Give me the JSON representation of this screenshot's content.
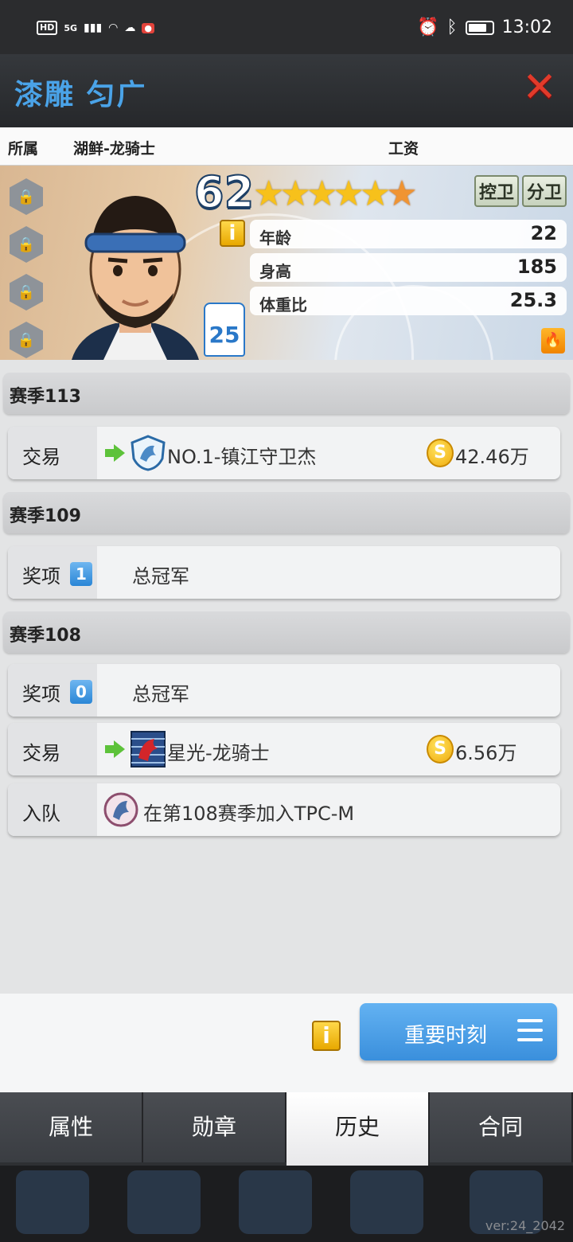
{
  "status_bar": {
    "time": "13:02",
    "network": "5G",
    "hd": "HD"
  },
  "header": {
    "player_name": "漆雕 匀广",
    "close_icon": "close-icon"
  },
  "team_row": {
    "affiliation_label": "所属",
    "team": "湖鲜-龙骑士",
    "salary_label": "工资"
  },
  "player_card": {
    "rating": "62",
    "stars": {
      "full": 5,
      "half": 1
    },
    "positions": [
      "控卫",
      "分卫"
    ],
    "jersey_number": "25",
    "stats": [
      {
        "label": "年龄",
        "value": "22"
      },
      {
        "label": "身高",
        "value": "185"
      },
      {
        "label": "体重比",
        "value": "25.3"
      }
    ],
    "info_icon": "i"
  },
  "history": {
    "seasons": [
      {
        "label": "赛季113"
      },
      {
        "label": "赛季109"
      },
      {
        "label": "赛季108"
      }
    ],
    "entries": [
      {
        "type": "交易",
        "team": "NO.1-镇江守卫杰",
        "fee": "42.46万"
      },
      {
        "type": "奖项",
        "award_count": "1",
        "text": "总冠军"
      },
      {
        "type": "奖项",
        "award_count": "0",
        "text": "总冠军"
      },
      {
        "type": "交易",
        "team": "星光-龙骑士",
        "fee": "6.56万"
      },
      {
        "type": "入队",
        "text": "在第108赛季加入TPC-M"
      }
    ]
  },
  "actions": {
    "info_label": "i",
    "moments_button": "重要时刻"
  },
  "tabs": [
    {
      "label": "属性",
      "active": false
    },
    {
      "label": "勋章",
      "active": false
    },
    {
      "label": "历史",
      "active": true
    },
    {
      "label": "合同",
      "active": false
    }
  ],
  "version": "ver:24_2042",
  "colors": {
    "accent_blue": "#4aa3e8",
    "close_red": "#e23a2a",
    "star_gold": "#f7c11b",
    "active_tab": "#ffffff"
  }
}
